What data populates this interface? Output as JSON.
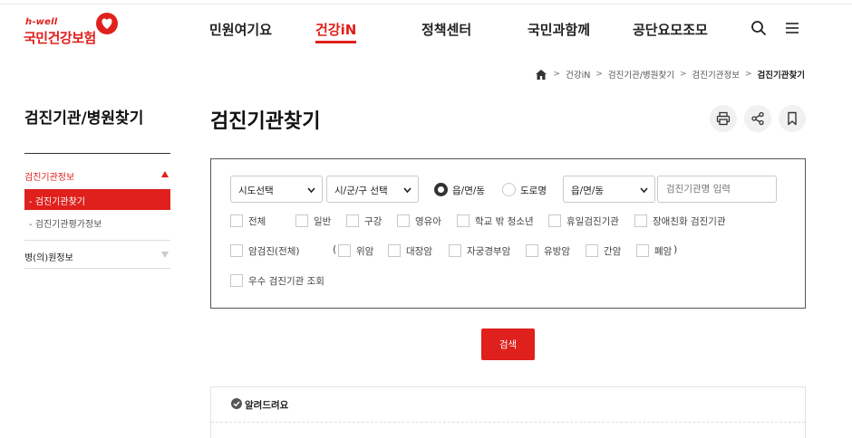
{
  "brand": {
    "logo_small": "h-well",
    "logo_main": "국민건강보험",
    "accent": "#e0201c"
  },
  "gnb": {
    "items": [
      "민원여기요",
      "건강iN",
      "정책센터",
      "국민과함께",
      "공단요모조모"
    ],
    "active_index": 1
  },
  "header_icons": [
    "search-icon",
    "menu-icon"
  ],
  "breadcrumb": [
    "건강iN",
    "검진기관/병원찾기",
    "검진기관정보",
    "검진기관찾기"
  ],
  "sidebar": {
    "title": "검진기관/병원찾기",
    "groups": [
      {
        "label": "검진기관정보",
        "expanded": true,
        "items": [
          {
            "label": "- 검진기관찾기",
            "active": true
          },
          {
            "label": "- 검진기관평가정보",
            "active": false
          }
        ]
      },
      {
        "label": "병(의)원정보",
        "expanded": false,
        "items": []
      }
    ]
  },
  "page": {
    "title": "검진기관찾기",
    "tools": [
      "print-icon",
      "share-icon",
      "bookmark-icon"
    ]
  },
  "search": {
    "sido_select": "시도선택",
    "sigungu_select": "시/군/구 선택",
    "radio_options": [
      {
        "label": "읍/면/동",
        "checked": true
      },
      {
        "label": "도로명",
        "checked": false
      }
    ],
    "dong_select": "읍/면/동",
    "name_placeholder": "검진기관명 입력",
    "row1_checks": [
      "전체",
      "일반",
      "구강",
      "영유아",
      "학교 밖 청소년",
      "휴일검진기관",
      "장애친화 검진기관"
    ],
    "cancer_all": "암검진(전체)",
    "paren_open": "(",
    "paren_close": ")",
    "cancer_checks": [
      "위암",
      "대장암",
      "자궁경부암",
      "유방암",
      "간암",
      "폐암"
    ],
    "excellent_check": "우수 검진기관 조회",
    "button": "검색"
  },
  "notice": {
    "title": "알려드려요"
  }
}
